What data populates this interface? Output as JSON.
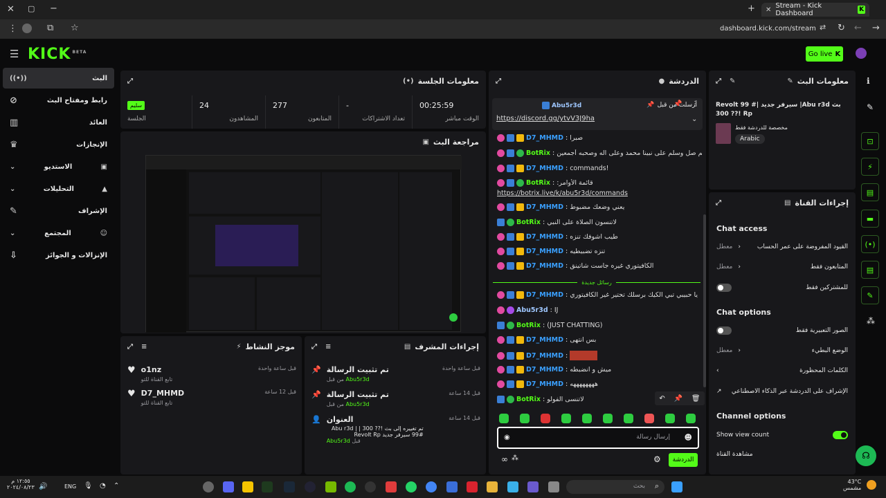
{
  "browser": {
    "tab_title": "Stream - Kick Dashboard",
    "url": "dashboard.kick.com/stream"
  },
  "header": {
    "logo": "KICK",
    "beta": "BETA",
    "go_live": "Go live"
  },
  "sidebar": {
    "items": [
      {
        "label": "البث",
        "icon": "broadcast-icon"
      },
      {
        "label": "رابط ومفتاح البث",
        "icon": "link-icon"
      },
      {
        "label": "العائد",
        "icon": "money-icon"
      },
      {
        "label": "الإنجازات",
        "icon": "trophy-icon"
      },
      {
        "label": "الاستديو",
        "icon": "studio-icon"
      },
      {
        "label": "التحليلات",
        "icon": "analytics-icon"
      },
      {
        "label": "الإشراف",
        "icon": "wrench-icon"
      },
      {
        "label": "المجتمع",
        "icon": "community-icon"
      },
      {
        "label": "الإنزالات و الجوائز",
        "icon": "drops-icon"
      }
    ]
  },
  "session": {
    "title": "معلومات الجلسة",
    "badge": "سليم",
    "badge_label": "الجلسة",
    "stats": [
      {
        "value": "24",
        "label": "المشاهدون"
      },
      {
        "value": "277",
        "label": "المتابعون"
      },
      {
        "value": "-",
        "label": "تعداد الاشتراكات"
      },
      {
        "value": "00:25:59",
        "label": "الوقت مباشر"
      }
    ]
  },
  "preview": {
    "title": "مراجعة البث"
  },
  "activity": {
    "title": "موجز النشاط",
    "items": [
      {
        "name": "o1nz",
        "desc": "تابع القناة للتو",
        "time": "قبل ساعة واحدة"
      },
      {
        "name": "D7_MHMD",
        "desc": "تابع القناة للتو",
        "time": "قبل 12 ساعة"
      }
    ]
  },
  "modactions": {
    "title": "إجراءات المشرف",
    "items": [
      {
        "title": "تم تثبيت الرسالة",
        "by": "من قبل",
        "user": "Abu5r3d",
        "time": "قبل ساعة واحدة"
      },
      {
        "title": "تم تثبيت الرسالة",
        "by": "من قبل",
        "user": "Abu5r3d",
        "time": "قبل 14 ساعة"
      },
      {
        "title": "العنوان",
        "desc": "تم تغييره إلى بث !?? 300 | Abu r3d | 99# سيرفر جديد Revolt Rp",
        "by": "قبل",
        "user": "Abu5r3d",
        "time": "قبل 14 ساعة"
      }
    ]
  },
  "chat": {
    "title": "الدردشة",
    "pinned_by": "أرسلت من قبل",
    "pinned_user": "Abu5r3d",
    "pinned_link": "https://discord.gg/ytvV3J9ha",
    "messages": [
      {
        "user": "D7_MHMD",
        "text": "صبرا",
        "c": "u1",
        "badges": [
          "pink",
          "blue",
          "yel"
        ]
      },
      {
        "user": "BotRix",
        "text": "اللهم صل وسلم على نبينا محمد وعلى آله وصحبه أجمعين",
        "c": "u2",
        "badges": [
          "pink",
          "blue",
          "grn"
        ]
      },
      {
        "user": "D7_MHMD",
        "text": "!commands",
        "c": "u1",
        "badges": [
          "pink",
          "blue",
          "yel"
        ]
      },
      {
        "user": "BotRix",
        "text": "قائمة الأوامر:",
        "c": "u2",
        "badges": [
          "pink",
          "blue",
          "grn"
        ]
      },
      {
        "user": "",
        "text": "https://botrix.live/k/abu5r3d/commands",
        "c": "link",
        "badges": []
      },
      {
        "user": "D7_MHMD",
        "text": "يعني وضعك مضبوط",
        "c": "u1",
        "badges": [
          "pink",
          "blue",
          "yel"
        ]
      },
      {
        "user": "BotRix",
        "text": "لاتنسون الصلاة على النبي",
        "c": "u2",
        "badges": [
          "blue",
          "grn"
        ]
      },
      {
        "user": "D7_MHMD",
        "text": "طيب اشوفك تنزه",
        "c": "u1",
        "badges": [
          "pink",
          "blue",
          "yel"
        ]
      },
      {
        "user": "D7_MHMD",
        "text": "تنزه تضبيطيه",
        "c": "u1",
        "badges": [
          "pink",
          "blue",
          "yel"
        ]
      },
      {
        "user": "D7_MHMD",
        "text": "الكافيتوري غيره جاست شاتينق",
        "c": "u1",
        "badges": [
          "pink",
          "blue",
          "yel"
        ]
      },
      {
        "user": "D7_MHMD",
        "text": "يا حبيبي تبي الكيك برسلك تحتير غير الكافيتوري",
        "c": "u1",
        "badges": [
          "pink",
          "blue",
          "yel"
        ]
      },
      {
        "user": "Abu5r3d",
        "text": "IJ",
        "c": "u3",
        "badges": [
          "pink",
          "pur"
        ]
      },
      {
        "user": "BotRix",
        "text": "(JUST CHATTING)",
        "c": "u2",
        "badges": [
          "blue",
          "grn"
        ]
      },
      {
        "user": "D7_MHMD",
        "text": "بس انتهى",
        "c": "u1",
        "badges": [
          "pink",
          "blue",
          "yel"
        ]
      },
      {
        "user": "D7_MHMD",
        "text": "",
        "c": "u1",
        "badges": [
          "pink",
          "blue",
          "yel"
        ],
        "emote": true
      },
      {
        "user": "D7_MHMD",
        "text": "ميش و انضبطه",
        "c": "u1",
        "badges": [
          "pink",
          "blue",
          "yel"
        ]
      },
      {
        "user": "D7_MHMD",
        "text": "ههههههههه",
        "c": "u1",
        "badges": [
          "pink",
          "blue",
          "yel"
        ]
      },
      {
        "user": "BotRix",
        "text": "لاتنسى الفولو",
        "c": "u2",
        "badges": [
          "blue",
          "grn"
        ]
      }
    ],
    "new_messages": "رسائل جديدة",
    "input_placeholder": "إرسال رسالة",
    "send": "الدردشة"
  },
  "streaminfo": {
    "title": "معلومات البث",
    "stream_title": "Revolt سيرفر جديد |# 99 |Abu r3d بث !?? 300 Rp",
    "category": "مخصصة للدردشة فقط",
    "tag": "Arabic"
  },
  "channelactions": {
    "title": "إجراءات القناة",
    "chat_access": "Chat access",
    "access_items": [
      {
        "label": "القيود المفروضة على عمر الحساب",
        "value": "معطل"
      },
      {
        "label": "المتابعون فقط",
        "value": "معطل"
      },
      {
        "label": "للمشتركين فقط",
        "value": ""
      }
    ],
    "chat_options": "Chat options",
    "option_items": [
      {
        "label": "الصور التعبيرية فقط",
        "value": ""
      },
      {
        "label": "الوضع البطيء",
        "value": "معطل"
      },
      {
        "label": "الكلمات المحظورة",
        "value": ""
      },
      {
        "label": "الإشراف على الدردشة عبر الذكاء الاصطناعي",
        "value": ""
      }
    ],
    "channel_options": "Channel options",
    "show_view_count": "Show view count",
    "watch_channel": "مشاهدة القناة"
  },
  "taskbar": {
    "time": "١٢:٥٥ م",
    "date": "٢٠٢٤/٠٨/٢٣",
    "lang": "ENG",
    "search": "بحث",
    "weather": "43°C",
    "weather_desc": "مشمس"
  },
  "colors": {
    "accent": "#53fc18",
    "panel": "#18181b",
    "bg": "#0b0b0c"
  }
}
